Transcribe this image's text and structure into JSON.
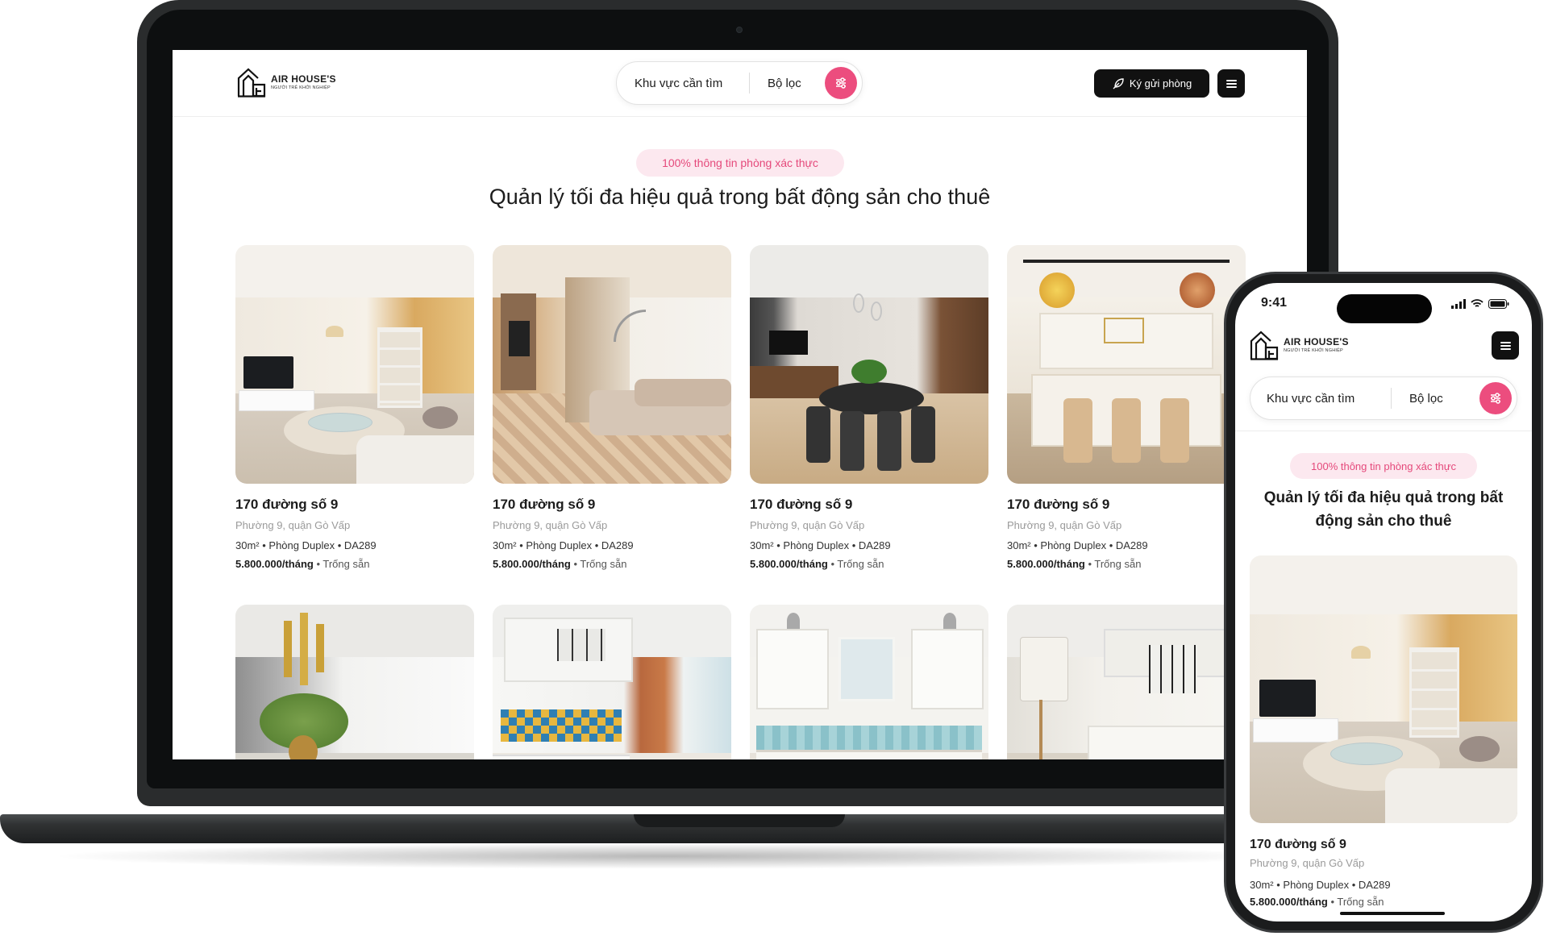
{
  "brand": {
    "name": "AIR HOUSE'S",
    "tagline": "NGƯỜI TRẺ KHỞI NGHIỆP"
  },
  "search": {
    "area_label": "Khu vực cần tìm",
    "filter_label": "Bộ lọc"
  },
  "header": {
    "consign_label": "Ký gửi phòng"
  },
  "hero": {
    "badge": "100% thông tin phòng xác thực",
    "title": "Quản lý tối đa hiệu quả trong bất động sản cho thuê"
  },
  "listings": [
    {
      "title": "170 đường số 9",
      "address": "Phường 9, quận Gò Vấp",
      "area": "30m²",
      "type": "Phòng Duplex",
      "code": "DA289",
      "price": "5.800.000/tháng",
      "status": "Trống sẵn"
    },
    {
      "title": "170 đường số 9",
      "address": "Phường 9, quận Gò Vấp",
      "area": "30m²",
      "type": "Phòng Duplex",
      "code": "DA289",
      "price": "5.800.000/tháng",
      "status": "Trống sẵn"
    },
    {
      "title": "170 đường số 9",
      "address": "Phường 9, quận Gò Vấp",
      "area": "30m²",
      "type": "Phòng Duplex",
      "code": "DA289",
      "price": "5.800.000/tháng",
      "status": "Trống sẵn"
    },
    {
      "title": "170 đường số 9",
      "address": "Phường 9, quận Gò Vấp",
      "area": "30m²",
      "type": "Phòng Duplex",
      "code": "DA289",
      "price": "5.800.000/tháng",
      "status": "Trống sẵn"
    }
  ],
  "phone": {
    "time": "9:41"
  },
  "colors": {
    "accent": "#ec4d7e",
    "accent_soft": "#fce8ef",
    "dark": "#111111"
  },
  "icons": {
    "filter": "sliders-icon",
    "consign": "feather-pen-icon",
    "menu": "hamburger-icon",
    "logo": "house-logo-icon"
  }
}
